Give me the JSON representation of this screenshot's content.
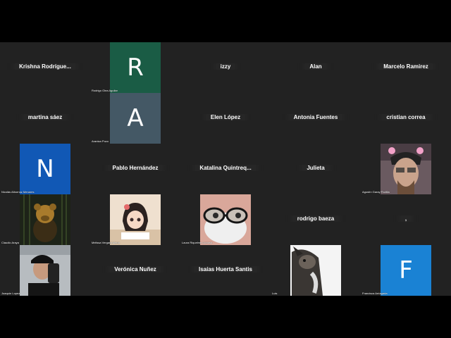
{
  "participants": [
    {
      "display": "Krishna  Rodrígue..."
    },
    {
      "initial": "R",
      "label": "Rodrigo Olea Aguilar",
      "color": "#1a5c45"
    },
    {
      "display": "izzy"
    },
    {
      "display": "Alan"
    },
    {
      "display": "Marcelo Ramirez"
    },
    {
      "display": "martina sáez"
    },
    {
      "initial": "A",
      "label": "Arantza Pozo",
      "color": "#445865"
    },
    {
      "display": "Elen López"
    },
    {
      "display": "Antonia Fuentes"
    },
    {
      "display": "cristian correa"
    },
    {
      "initial": "N",
      "label": "Nicolás Albornoz Menares",
      "color": "#1158b5"
    },
    {
      "display": "Pablo Hernández"
    },
    {
      "display": "Katalina  Quintreq..."
    },
    {
      "display": "Julieta"
    },
    {
      "label": "Agustín Garay Padilla"
    },
    {
      "label": "Claudio Araya"
    },
    {
      "label": "Melissa Vergara Mena"
    },
    {
      "label": "Laura Riquelme Donoso"
    },
    {
      "display": "rodrigo baeza"
    },
    {
      "display": ","
    },
    {
      "label": "Joaquín Lopez"
    },
    {
      "display": "Verónica Nuñez"
    },
    {
      "display": "Isaías Huerta Santis"
    },
    {
      "label": "Luis"
    },
    {
      "initial": "F",
      "label": "Francisca Arriagada",
      "color": "#1a82d4"
    }
  ]
}
